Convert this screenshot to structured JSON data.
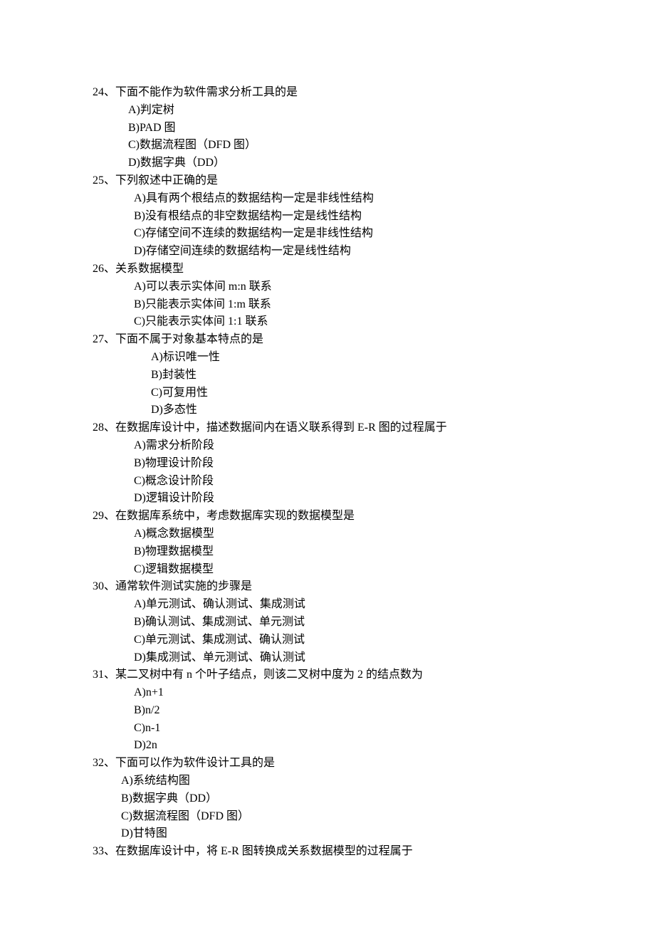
{
  "questions": [
    {
      "num": "24、",
      "text": "下面不能作为软件需求分析工具的是",
      "indent": "i1",
      "opts": [
        "A)判定树",
        "B)PAD 图",
        "C)数据流程图（DFD 图）",
        "D)数据字典（DD）"
      ]
    },
    {
      "num": "25、",
      "text": "下列叙述中正确的是",
      "indent": "i2",
      "opts": [
        "A)具有两个根结点的数据结构一定是非线性结构",
        "B)没有根结点的非空数据结构一定是线性结构",
        "C)存储空间不连续的数据结构一定是非线性结构",
        "D)存储空间连续的数据结构一定是线性结构"
      ]
    },
    {
      "num": "26、",
      "text": "关系数据模型",
      "indent": "i2",
      "opts": [
        "A)可以表示实体间 m:n 联系",
        "B)只能表示实体间 1:m 联系",
        "C)只能表示实体间 1:1 联系"
      ]
    },
    {
      "num": "27、",
      "text": "下面不属于对象基本特点的是",
      "indent": "i3",
      "opts": [
        "A)标识唯一性",
        "B)封装性",
        "C)可复用性",
        "D)多态性"
      ]
    },
    {
      "num": "28、",
      "text": "在数据库设计中，描述数据间内在语义联系得到 E-R 图的过程属于",
      "indent": "i2",
      "opts": [
        "A)需求分析阶段",
        "B)物理设计阶段",
        "C)概念设计阶段",
        "D)逻辑设计阶段"
      ]
    },
    {
      "num": "29、",
      "text": "在数据库系统中，考虑数据库实现的数据模型是",
      "indent": "i2",
      "opts": [
        "A)概念数据模型",
        "B)物理数据模型",
        "C)逻辑数据模型"
      ]
    },
    {
      "num": "30、",
      "text": "通常软件测试实施的步骤是",
      "indent": "i2",
      "opts": [
        "A)单元测试、确认测试、集成测试",
        "B)确认测试、集成测试、单元测试",
        "C)单元测试、集成测试、确认测试",
        "D)集成测试、单元测试、确认测试"
      ]
    },
    {
      "num": "31、",
      "text": "某二叉树中有 n 个叶子结点，则该二叉树中度为 2 的结点数为",
      "indent": "i2",
      "opts": [
        "A)n+1",
        "B)n/2",
        "C)n-1",
        "D)2n"
      ]
    },
    {
      "num": "32、",
      "text": "下面可以作为软件设计工具的是",
      "indent": "i4",
      "opts": [
        "A)系统结构图",
        "B)数据字典（DD）",
        "C)数据流程图（DFD 图）",
        "D)甘特图"
      ]
    },
    {
      "num": "33、",
      "text": "在数据库设计中，将 E-R 图转换成关系数据模型的过程属于",
      "indent": "",
      "opts": []
    }
  ]
}
